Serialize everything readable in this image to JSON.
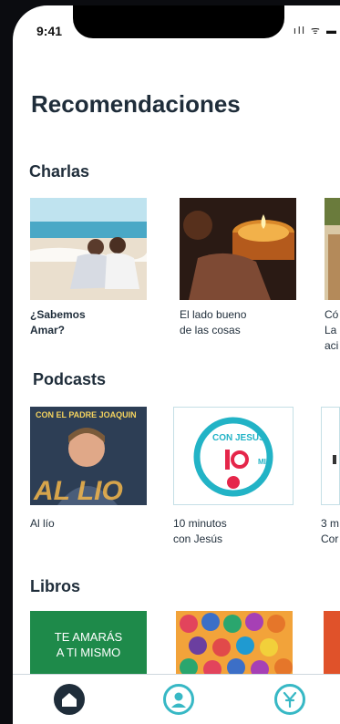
{
  "status_bar": {
    "time": "9:41",
    "icons": "ıll ᯤ ▬"
  },
  "page": {
    "title": "Recomendaciones"
  },
  "sections": {
    "talks": {
      "title": "Charlas",
      "items": [
        {
          "title": "¿Sabemos\nAmar?"
        },
        {
          "title": "El lado bueno\nde las cosas"
        },
        {
          "title": "Có\nLa\naci"
        }
      ]
    },
    "podcasts": {
      "title": "Podcasts",
      "items": [
        {
          "title": "Al lío",
          "cover_top": "CON EL PADRE JOAQUIN",
          "cover_bottom": "AL LIO"
        },
        {
          "title": "10 minutos\ncon Jesús",
          "cover_top": "CON JESUS",
          "cover_bottom": "MIN"
        },
        {
          "title": "3 m\nCor"
        }
      ]
    },
    "books": {
      "title": "Libros",
      "items": [
        {
          "cover_title": "TE AMARÁS\nA TI MISMO"
        },
        {
          "cover_title": ""
        }
      ]
    }
  },
  "tabbar": {
    "items": [
      {
        "icon": "home-icon",
        "active": true
      },
      {
        "icon": "profile-icon",
        "active": false
      },
      {
        "icon": "logo-icon",
        "active": false
      }
    ],
    "colors": {
      "active": "#1f2d3a",
      "inactive": "#37b8c5"
    }
  }
}
